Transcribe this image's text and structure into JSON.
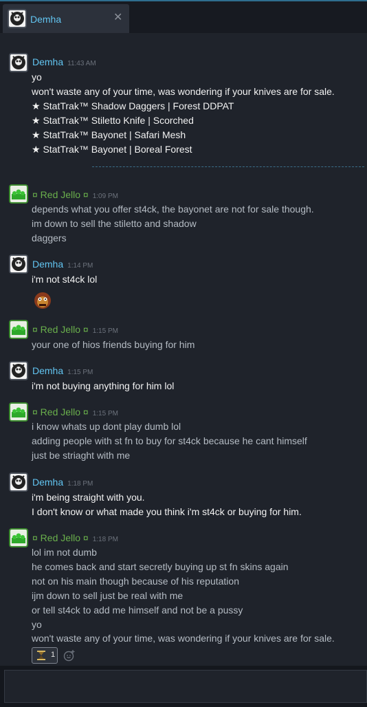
{
  "tab": {
    "title": "Demha",
    "close": "✕"
  },
  "messages": [
    {
      "sender": "Demha",
      "time": "11:43 AM",
      "lines": [
        "yo",
        "won't waste any of your time, was wondering if your knives are for sale.",
        "★ StatTrak™ Shadow Daggers | Forest DDPAT",
        "★ StatTrak™ Stiletto Knife | Scorched",
        "★ StatTrak™ Bayonet | Safari Mesh",
        "★ StatTrak™ Bayonet | Boreal Forest"
      ]
    },
    {
      "sender": "¤ Red Jello ¤",
      "time": "1:09 PM",
      "lines": [
        "depends what you offer st4ck, the bayonet are not for sale though.",
        "im down to sell the stiletto and shadow",
        "daggers"
      ]
    },
    {
      "sender": "Demha",
      "time": "1:14 PM",
      "lines": [
        "i'm not st4ck lol"
      ]
    },
    {
      "sender": "¤ Red Jello ¤",
      "time": "1:15 PM",
      "lines": [
        "your one of hios friends buying for him"
      ]
    },
    {
      "sender": "Demha",
      "time": "1:15 PM",
      "lines": [
        "i'm not buying anything for him lol"
      ]
    },
    {
      "sender": "¤ Red Jello ¤",
      "time": "1:15 PM",
      "lines": [
        "i know whats up dont play dumb lol",
        "adding people with st fn to buy for st4ck because he cant himself",
        "just be striaght with me"
      ]
    },
    {
      "sender": "Demha",
      "time": "1:18 PM",
      "lines": [
        "i'm being straight with you.",
        "I don't know or what made you think i'm st4ck or buying for him."
      ]
    },
    {
      "sender": "¤ Red Jello ¤",
      "time": "1:18 PM",
      "lines": [
        "lol im not dumb",
        "he comes back and start secretly buying up st fn skins again",
        "not on his main though because of his reputation",
        "ijm down to sell just be real with me",
        "or tell st4ck to add me himself and not be a pussy",
        "yo",
        "won't waste any of your time, was wondering if your knives are for sale."
      ]
    }
  ],
  "reaction": {
    "count": "1"
  }
}
